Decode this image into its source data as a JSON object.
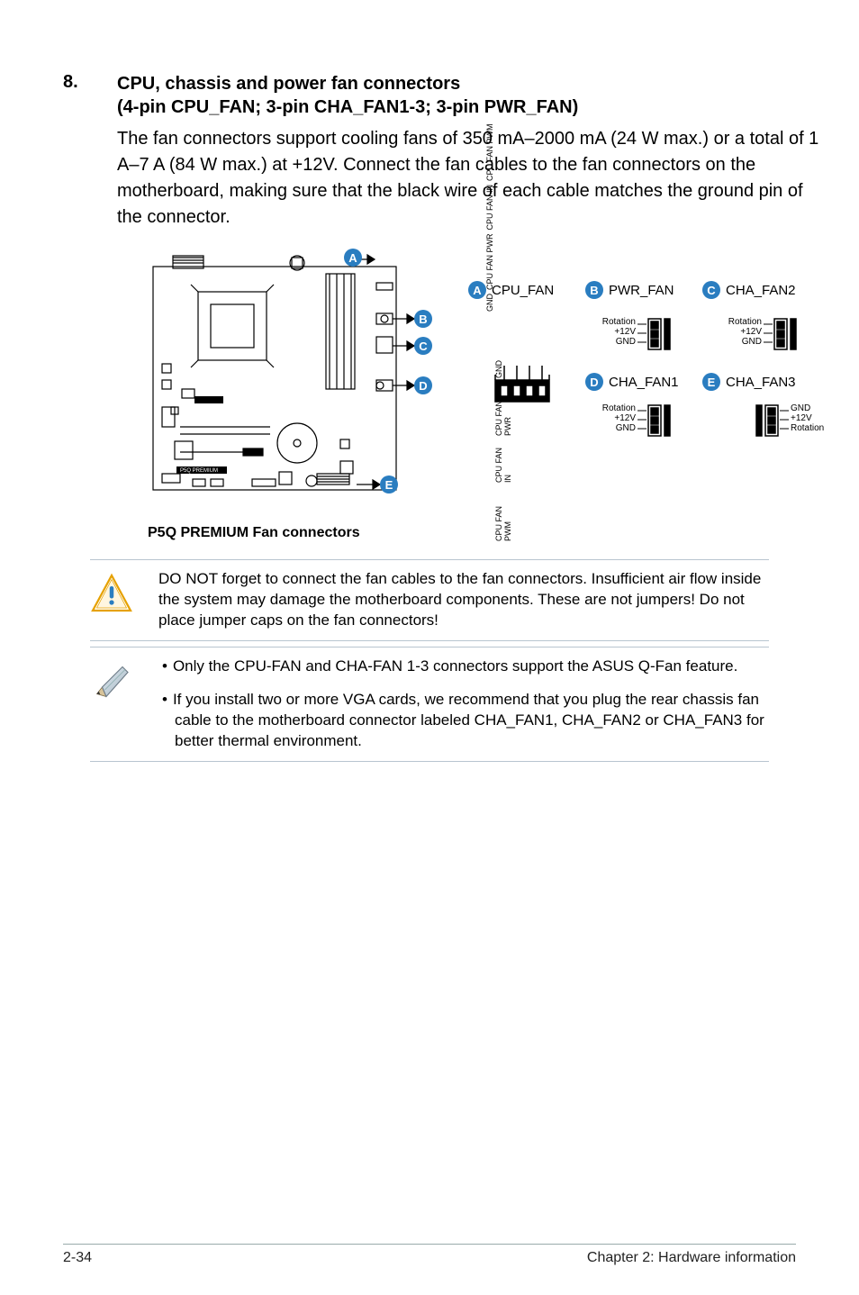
{
  "section": {
    "number": "8.",
    "title_line1": "CPU, chassis and power fan connectors",
    "title_line2": "(4-pin CPU_FAN; 3-pin CHA_FAN1-3; 3-pin PWR_FAN)",
    "paragraph": "The fan connectors support cooling fans of 350 mA–2000 mA (24 W max.) or a total of 1 A–7 A (84 W max.) at +12V. Connect the fan cables to the fan connectors on the motherboard, making sure that the black wire of each cable matches the ground pin of the connector."
  },
  "diagram": {
    "caption": "P5Q PREMIUM Fan connectors",
    "board_label": "P5Q PREMIUM",
    "badges": {
      "A": "A",
      "B": "B",
      "C": "C",
      "D": "D",
      "E": "E"
    },
    "headers": {
      "A": "CPU_FAN",
      "B": "PWR_FAN",
      "C": "CHA_FAN2",
      "D": "CHA_FAN1",
      "E": "CHA_FAN3"
    },
    "cpu_fan_pins": [
      "GND",
      "CPU FAN PWR",
      "CPU FAN IN",
      "CPU FAN PWM"
    ],
    "three_pin": {
      "rotation": "Rotation",
      "v12": "+12V",
      "gnd": "GND"
    }
  },
  "warning": "DO NOT forget to connect the fan cables to the fan connectors. Insufficient air flow inside the system may damage the motherboard components. These are not jumpers! Do not place jumper caps on the fan connectors!",
  "notes": [
    "Only the CPU-FAN and CHA-FAN 1-3 connectors support the ASUS Q-Fan feature.",
    "If you install two or more VGA cards, we recommend that you plug the rear chassis fan cable to the motherboard connector labeled CHA_FAN1, CHA_FAN2 or CHA_FAN3 for better thermal environment."
  ],
  "footer": {
    "page": "2-34",
    "chapter": "Chapter 2: Hardware information"
  }
}
